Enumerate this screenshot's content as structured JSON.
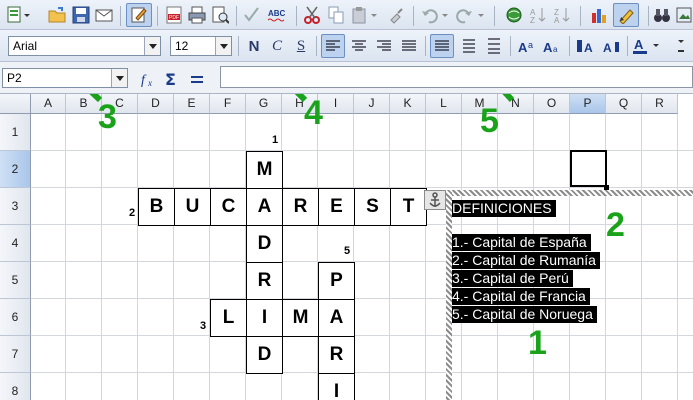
{
  "toolbar_format": {
    "font_name": "Arial",
    "font_size": "12",
    "bold_label": "N",
    "italic_label": "C",
    "underline_label": "S"
  },
  "formula_bar": {
    "cell_ref": "P2",
    "formula": ""
  },
  "columns": [
    "A",
    "B",
    "C",
    "D",
    "E",
    "F",
    "G",
    "H",
    "I",
    "J",
    "K",
    "L",
    "M",
    "N",
    "O",
    "P",
    "Q",
    "R"
  ],
  "selected_column": "P",
  "rows": [
    "1",
    "2",
    "3",
    "4",
    "5",
    "6",
    "7",
    "8"
  ],
  "selected_row": "2",
  "crossword": {
    "clue_numbers": [
      "1",
      "2",
      "3",
      "5"
    ],
    "bucarest": [
      "B",
      "U",
      "C",
      "A",
      "R",
      "E",
      "S",
      "T"
    ],
    "madrid": [
      "M",
      "A",
      "D",
      "R",
      "I",
      "D"
    ],
    "lima": [
      "L",
      "I",
      "M",
      "A"
    ],
    "paris": [
      "P",
      "A",
      "R",
      "I"
    ]
  },
  "definitions": {
    "title": "DEFINICIONES",
    "items": [
      "1.- Capital de España",
      "2.- Capital de Rumanía",
      "3.- Capital de Perú",
      "4.- Capital de Francia",
      "5.- Capital de Noruega"
    ]
  },
  "annotations": [
    "1",
    "2",
    "3",
    "4",
    "5"
  ],
  "colors": {
    "annotation": "#1aa31a",
    "selected_header": "#a9c6ea"
  }
}
